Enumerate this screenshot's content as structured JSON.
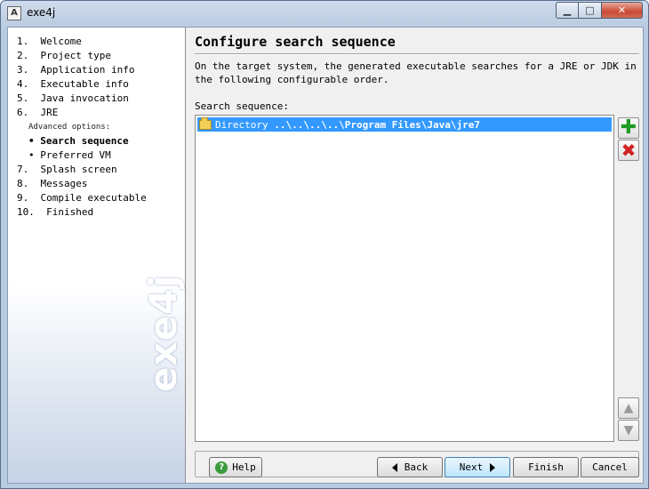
{
  "window": {
    "title": "exe4j",
    "app_icon_glyph": "A",
    "minimize_glyph": "▁",
    "maximize_glyph": "□",
    "close_glyph": "✕"
  },
  "sidebar": {
    "steps": [
      {
        "label": "1.  Welcome"
      },
      {
        "label": "2.  Project type"
      },
      {
        "label": "3.  Application info"
      },
      {
        "label": "4.  Executable info"
      },
      {
        "label": "5.  Java invocation"
      },
      {
        "label": "6.  JRE"
      }
    ],
    "advanced_label": "Advanced options:",
    "sub_steps": [
      {
        "label": "• Search sequence",
        "active": true
      },
      {
        "label": "• Preferred VM",
        "active": false
      }
    ],
    "steps_after": [
      {
        "label": "7.  Splash screen"
      },
      {
        "label": "8.  Messages"
      },
      {
        "label": "9.  Compile executable"
      },
      {
        "label": "10.  Finished"
      }
    ],
    "brand": "exe4j"
  },
  "main": {
    "heading": "Configure search sequence",
    "description": "On the target system, the generated executable searches for a JRE or JDK in the following configurable order.",
    "list_label": "Search sequence:",
    "items": [
      {
        "type_label": "Directory",
        "path": " ..\\..\\..\\..\\Program Files\\Java\\jre7",
        "icon": "folder-icon"
      }
    ]
  },
  "side_buttons": {
    "add_glyph": "✚",
    "remove_glyph": "✖",
    "up_glyph": "▲",
    "down_glyph": "▼"
  },
  "buttons": {
    "help": "Help",
    "help_icon": "?",
    "back": "Back",
    "next": "Next",
    "finish": "Finish",
    "cancel": "Cancel"
  }
}
